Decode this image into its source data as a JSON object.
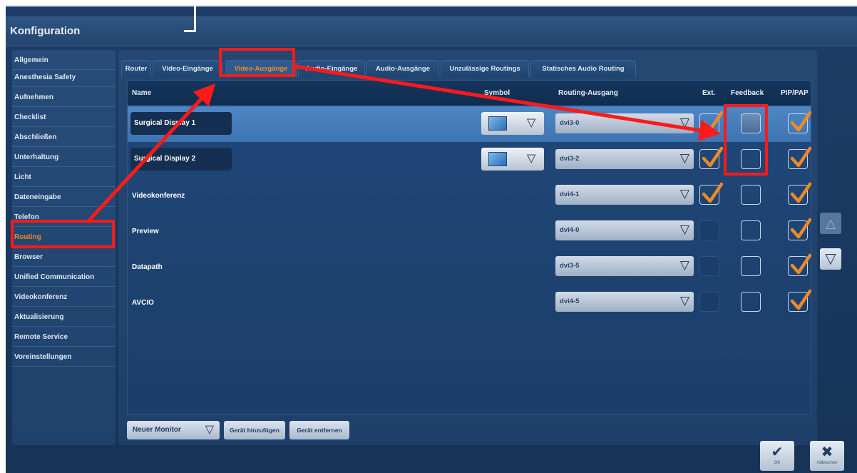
{
  "window": {
    "title": "Konfiguration"
  },
  "sidebar": {
    "items": [
      {
        "label": "Allgemein"
      },
      {
        "label": "Anesthesia Safety"
      },
      {
        "label": "Aufnehmen"
      },
      {
        "label": "Checklist"
      },
      {
        "label": "Abschließen"
      },
      {
        "label": "Unterhaltung"
      },
      {
        "label": "Licht"
      },
      {
        "label": "Dateneingabe"
      },
      {
        "label": "Telefon"
      },
      {
        "label": "Routing",
        "active": true
      },
      {
        "label": "Browser"
      },
      {
        "label": "Unified Communication"
      },
      {
        "label": "Videokonferenz"
      },
      {
        "label": "Aktualisierung"
      },
      {
        "label": "Remote Service"
      },
      {
        "label": "Voreinstellungen"
      }
    ]
  },
  "tabs": [
    {
      "label": "Router"
    },
    {
      "label": "Video-Eingänge"
    },
    {
      "label": "Video-Ausgänge",
      "active": true
    },
    {
      "label": "Audio-Eingänge"
    },
    {
      "label": "Audio-Ausgänge"
    },
    {
      "label": "Unzulässige Routings"
    },
    {
      "label": "Statisches Audio Routing"
    }
  ],
  "table": {
    "headers": {
      "name": "Name",
      "symbol": "Symbol",
      "routing": "Routing-Ausgang",
      "ext": "Ext.",
      "feedback": "Feedback",
      "pip": "PIP/PAP"
    },
    "rows": [
      {
        "name": "Surgical Display 1",
        "routing": "dvi3-0",
        "ext": "checked",
        "feedback": "filled",
        "pip": "checked",
        "editable": true,
        "selected": true
      },
      {
        "name": "Surgical Display 2",
        "routing": "dvi3-2",
        "ext": "checked",
        "feedback": "empty",
        "pip": "checked",
        "editable": true
      },
      {
        "name": "Videokonferenz",
        "routing": "dvi4-1",
        "ext": "checked",
        "feedback": "empty",
        "pip": "checked"
      },
      {
        "name": "Preview",
        "routing": "dvi4-0",
        "ext": "dim",
        "feedback": "empty",
        "pip": "checked"
      },
      {
        "name": "Datapath",
        "routing": "dvi3-5",
        "ext": "dim",
        "feedback": "empty",
        "pip": "checked"
      },
      {
        "name": "AVCIO",
        "routing": "dvi4-5",
        "ext": "dim",
        "feedback": "empty",
        "pip": "checked"
      }
    ]
  },
  "buttons": {
    "new_monitor": "Neuer Monitor",
    "add_device": "Gerät hinzufügen",
    "remove_device": "Gerät entfernen",
    "ok": "OK",
    "cancel": "Abbrechen"
  },
  "icons": {
    "dropdown": "chevron-down-icon",
    "scroll_up": "triangle-up-icon",
    "scroll_down": "triangle-down-icon",
    "checkmark": "checkmark-icon",
    "close": "close-icon",
    "monitor": "monitor-icon"
  },
  "colors": {
    "accent": "#f08a25",
    "annotation": "#ff1a1a",
    "background": "#1d3d66",
    "selected_row": "#4f86c4"
  }
}
